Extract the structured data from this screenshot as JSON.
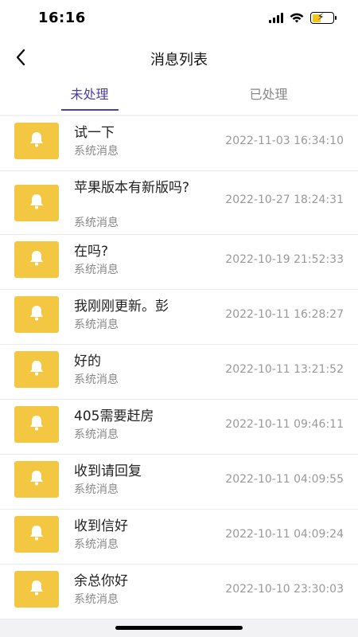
{
  "status_bar": {
    "time": "16:16"
  },
  "nav": {
    "title": "消息列表"
  },
  "tabs": [
    {
      "label": "未处理",
      "active": true
    },
    {
      "label": "已处理",
      "active": false
    }
  ],
  "messages": [
    {
      "title": "试一下",
      "subtitle": "系统消息",
      "time": "2022-11-03 16:34:10"
    },
    {
      "title": "苹果版本有新版吗?",
      "subtitle": "系统消息",
      "time": "2022-10-27 18:24:31"
    },
    {
      "title": "在吗?",
      "subtitle": "系统消息",
      "time": "2022-10-19 21:52:33"
    },
    {
      "title": "我刚刚更新。彭",
      "subtitle": "系统消息",
      "time": "2022-10-11 16:28:27"
    },
    {
      "title": "好的",
      "subtitle": "系统消息",
      "time": "2022-10-11 13:21:52"
    },
    {
      "title": "405需要赶房",
      "subtitle": "系统消息",
      "time": "2022-10-11 09:46:11"
    },
    {
      "title": "收到请回复",
      "subtitle": "系统消息",
      "time": "2022-10-11 04:09:55"
    },
    {
      "title": "收到信好",
      "subtitle": "系统消息",
      "time": "2022-10-11 04:09:24"
    },
    {
      "title": "余总你好",
      "subtitle": "系统消息",
      "time": "2022-10-10 23:30:03"
    }
  ],
  "colors": {
    "accent": "#4a3fa6",
    "icon_bg": "#f4c743"
  },
  "icons": {
    "back": "chevron-left-icon",
    "message": "bell-icon"
  }
}
